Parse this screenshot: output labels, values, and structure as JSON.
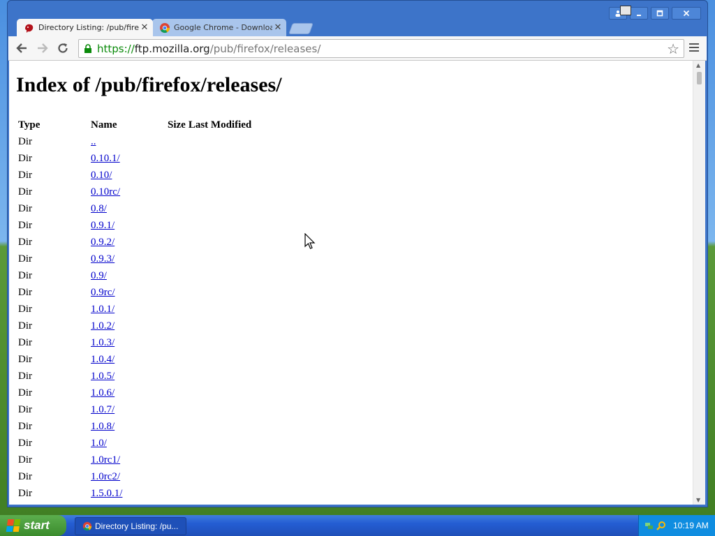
{
  "browser": {
    "tabs": [
      {
        "label": "Directory Listing: /pub/firefo",
        "icon": "firefox-icon",
        "active": true
      },
      {
        "label": "Google Chrome - Download fr",
        "icon": "chrome-icon",
        "active": false
      }
    ],
    "window_buttons": {
      "user": "user-icon",
      "minimize": "minimize-icon",
      "maximize": "maximize-icon",
      "close": "close-icon"
    },
    "address": {
      "scheme": "https://",
      "host": "ftp.mozilla.org",
      "path": "/pub/firefox/releases/"
    }
  },
  "page": {
    "title": "Index of /pub/firefox/releases/",
    "columns": [
      "Type",
      "Name",
      "Size",
      "Last Modified"
    ],
    "rows": [
      {
        "type": "Dir",
        "name": ".."
      },
      {
        "type": "Dir",
        "name": "0.10.1/"
      },
      {
        "type": "Dir",
        "name": "0.10/"
      },
      {
        "type": "Dir",
        "name": "0.10rc/"
      },
      {
        "type": "Dir",
        "name": "0.8/"
      },
      {
        "type": "Dir",
        "name": "0.9.1/"
      },
      {
        "type": "Dir",
        "name": "0.9.2/"
      },
      {
        "type": "Dir",
        "name": "0.9.3/"
      },
      {
        "type": "Dir",
        "name": "0.9/"
      },
      {
        "type": "Dir",
        "name": "0.9rc/"
      },
      {
        "type": "Dir",
        "name": "1.0.1/"
      },
      {
        "type": "Dir",
        "name": "1.0.2/"
      },
      {
        "type": "Dir",
        "name": "1.0.3/"
      },
      {
        "type": "Dir",
        "name": "1.0.4/"
      },
      {
        "type": "Dir",
        "name": "1.0.5/"
      },
      {
        "type": "Dir",
        "name": "1.0.6/"
      },
      {
        "type": "Dir",
        "name": "1.0.7/"
      },
      {
        "type": "Dir",
        "name": "1.0.8/"
      },
      {
        "type": "Dir",
        "name": "1.0/"
      },
      {
        "type": "Dir",
        "name": "1.0rc1/"
      },
      {
        "type": "Dir",
        "name": "1.0rc2/"
      },
      {
        "type": "Dir",
        "name": "1.5.0.1/"
      }
    ]
  },
  "taskbar": {
    "start_label": "start",
    "task_label": "Directory Listing: /pu...",
    "clock": "10:19 AM"
  },
  "colors": {
    "link": "#0000cc",
    "url_scheme": "#0a8a0a",
    "taskbar": "#245dd3",
    "start": "#3a8b2c"
  }
}
